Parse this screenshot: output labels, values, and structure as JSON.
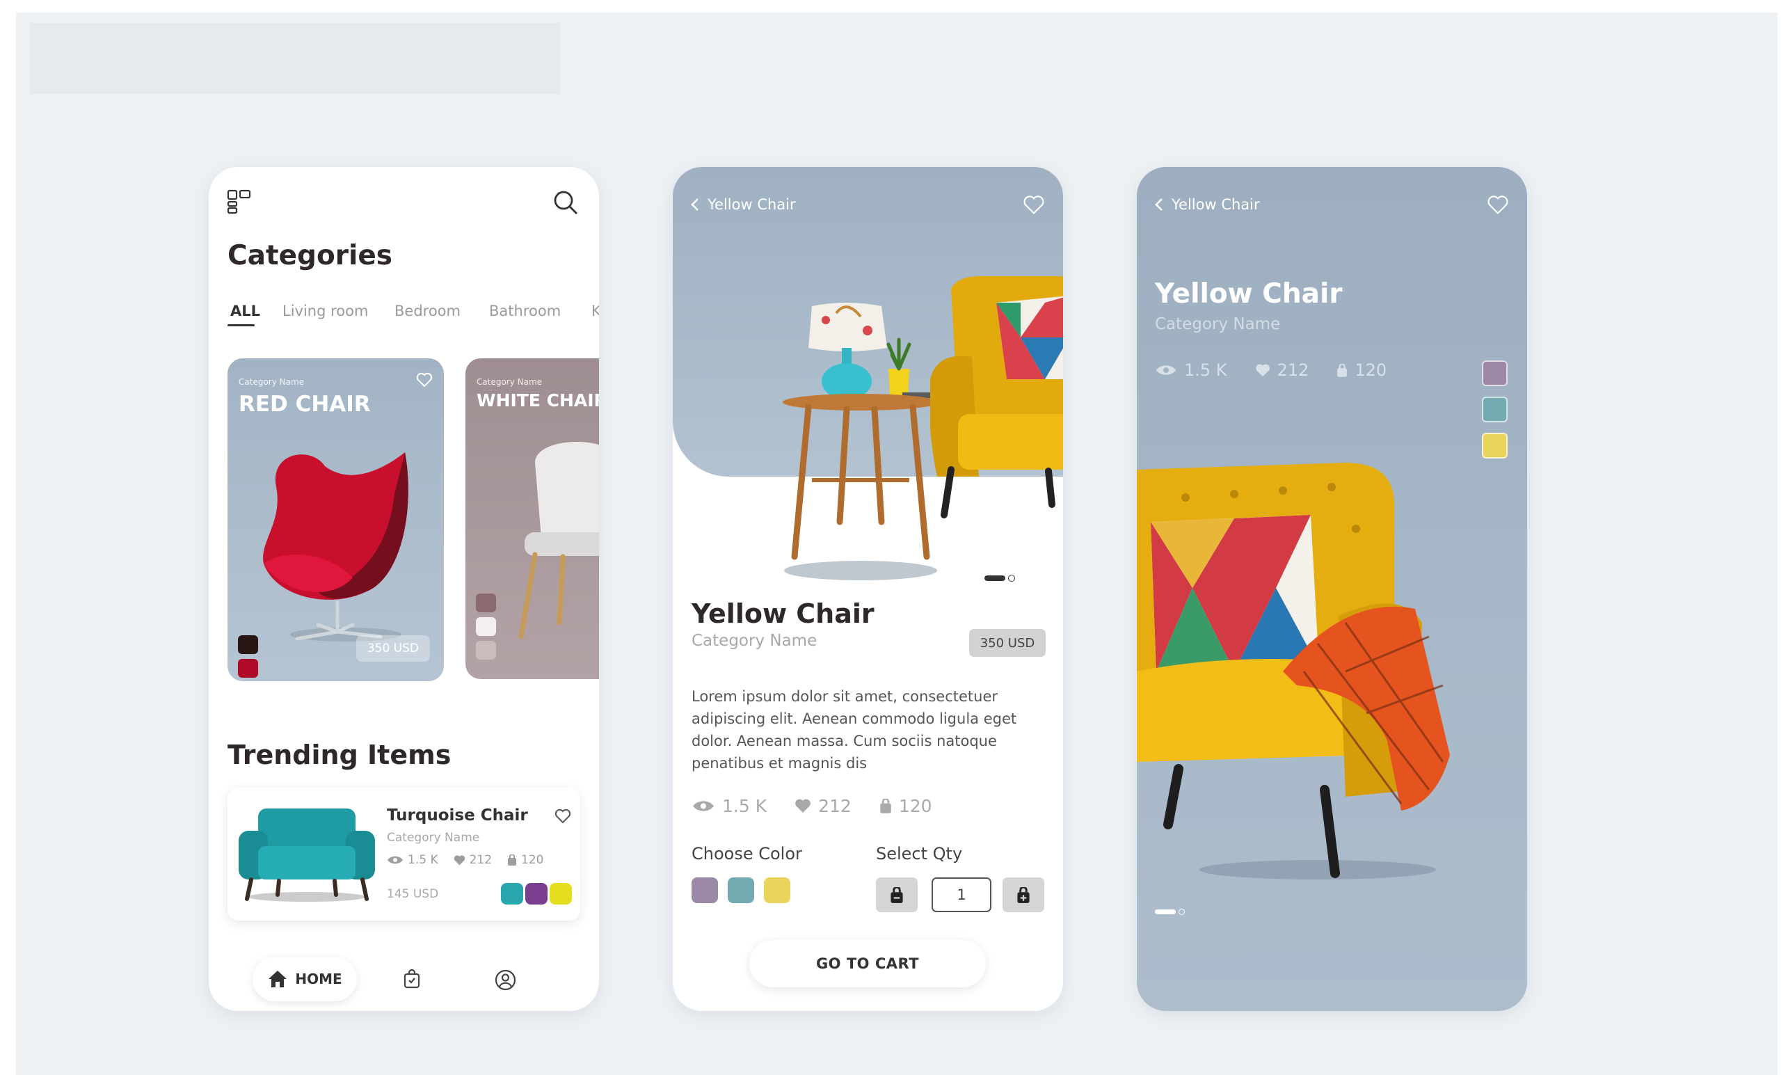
{
  "colors": {
    "background": "#edf1f4",
    "card_blue": "#a9bac9",
    "card_mauve": "#a29193",
    "chair_yellow": "#e8b10f",
    "accent_teal": "#2aa6ae"
  },
  "screen_categories": {
    "menu_icon": "grid-menu-icon",
    "search_icon": "search-icon",
    "title": "Categories",
    "tabs": [
      "ALL",
      "Living room",
      "Bedroom",
      "Bathroom",
      "K"
    ],
    "cards": [
      {
        "small": "Category Name",
        "name": "RED CHAIR",
        "price": "350 USD",
        "swatches": [
          "#2a1515",
          "#b00a2a",
          "#ffffff"
        ]
      },
      {
        "small": "Category Name",
        "name": "WHITE CHAIR",
        "swatches": [
          "#8a6a6e",
          "#f4eef3",
          "#c9bcbc"
        ]
      }
    ],
    "trending_title": "Trending Items",
    "trending": {
      "name": "Turquoise Chair",
      "category": "Category Name",
      "views": "1.5 K",
      "likes": "212",
      "bags": "120",
      "price": "145 USD",
      "dots": [
        "#2aa6ae",
        "#7a3e8e",
        "#e3df1f"
      ]
    },
    "nav": {
      "home": "HOME",
      "bag_icon": "shopping-bag-icon",
      "profile_icon": "profile-icon"
    }
  },
  "screen_detail": {
    "back_label": "Yellow Chair",
    "title": "Yellow Chair",
    "category": "Category Name",
    "price": "350 USD",
    "description": "Lorem ipsum dolor sit amet, consectetuer adipiscing elit. Aenean commodo ligula eget dolor. Aenean massa. Cum sociis natoque penatibus et magnis dis",
    "views": "1.5 K",
    "likes": "212",
    "bags": "120",
    "choose_color": "Choose Color",
    "colors": [
      "#9b89a6",
      "#73aab0",
      "#ead35a"
    ],
    "select_qty": "Select Qty",
    "qty": "1",
    "cart_button": "GO TO CART"
  },
  "screen_hero": {
    "back_label": "Yellow Chair",
    "title": "Yellow Chair",
    "category": "Category Name",
    "views": "1.5 K",
    "likes": "212",
    "bags": "120",
    "swatches": [
      "#9b89a6",
      "#73aab0",
      "#ead35a"
    ]
  }
}
